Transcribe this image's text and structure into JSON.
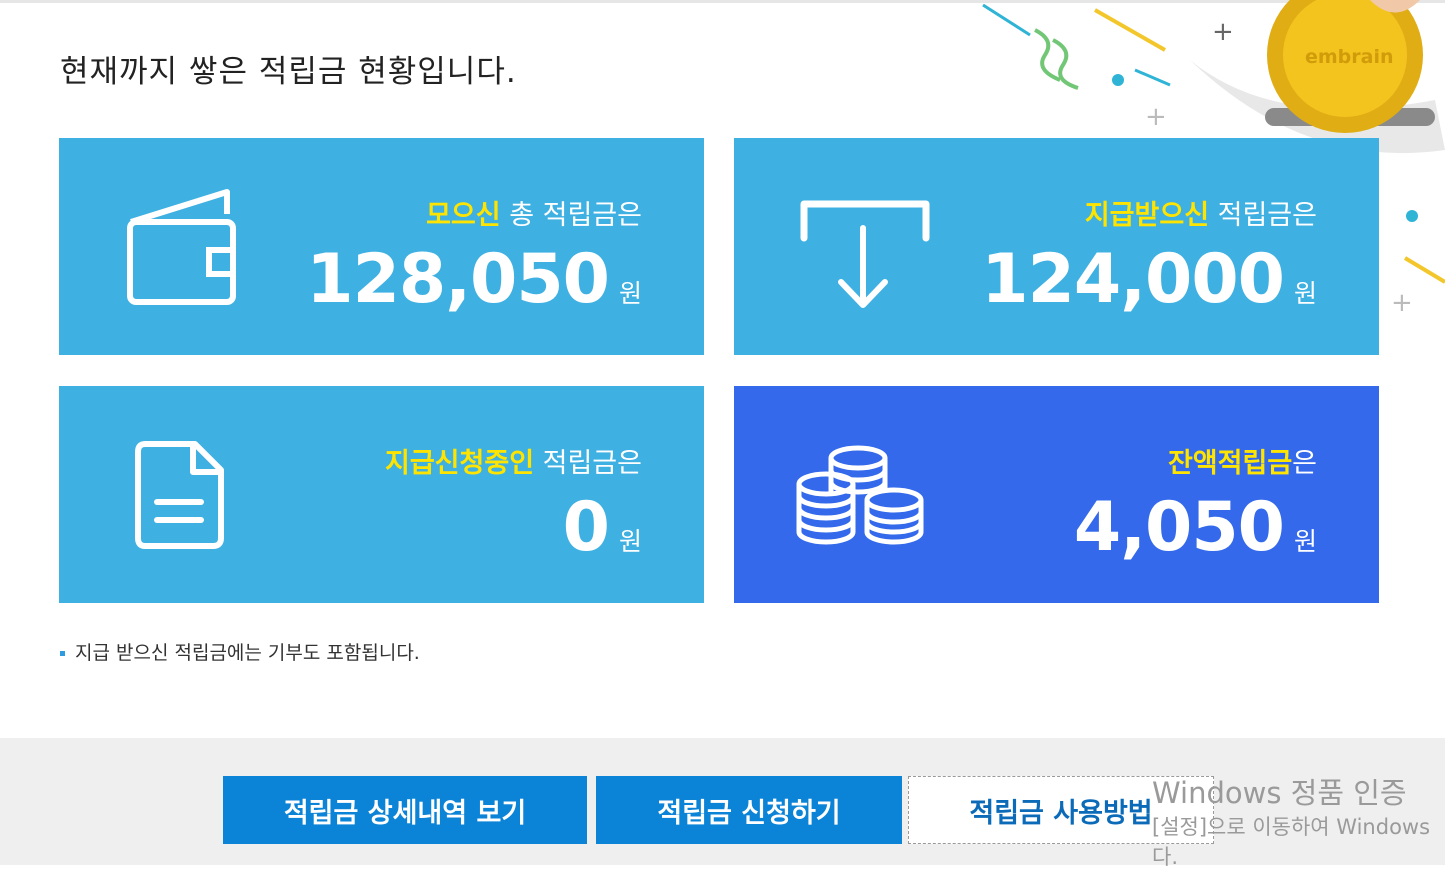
{
  "title": "현재까지 쌓은 적립금 현황입니다.",
  "decoration": {
    "coin_logo": "embrain"
  },
  "cards": [
    {
      "highlight": "모으신",
      "rest": " 총 적립금은",
      "amount": "128,050",
      "unit": "원",
      "icon": "wallet-icon",
      "color": "#3fb0e2"
    },
    {
      "highlight": "지급받으신",
      "rest": " 적립금은",
      "amount": "124,000",
      "unit": "원",
      "icon": "download-arrow-icon",
      "color": "#3fb0e2"
    },
    {
      "highlight": "지급신청중인",
      "rest": " 적립금은",
      "amount": "0",
      "unit": "원",
      "icon": "document-icon",
      "color": "#3fb0e2"
    },
    {
      "highlight": "잔액적립금",
      "rest": "은",
      "amount": "4,050",
      "unit": "원",
      "icon": "coins-icon",
      "color": "#3369ea"
    }
  ],
  "note": "지급 받으신 적립금에는 기부도 포함됩니다.",
  "buttons": {
    "history": "적립금 상세내역 보기",
    "apply": "적립금 신청하기",
    "howto": "적립금 사용방법"
  },
  "watermark": {
    "line1": "Windows 정품 인증",
    "line2": "[설정]으로 이동하여 Windows",
    "line3": "다."
  },
  "colors": {
    "highlight": "#ffe400",
    "card_light": "#3fb0e2",
    "card_dark": "#3369ea",
    "button": "#0b83d6"
  }
}
